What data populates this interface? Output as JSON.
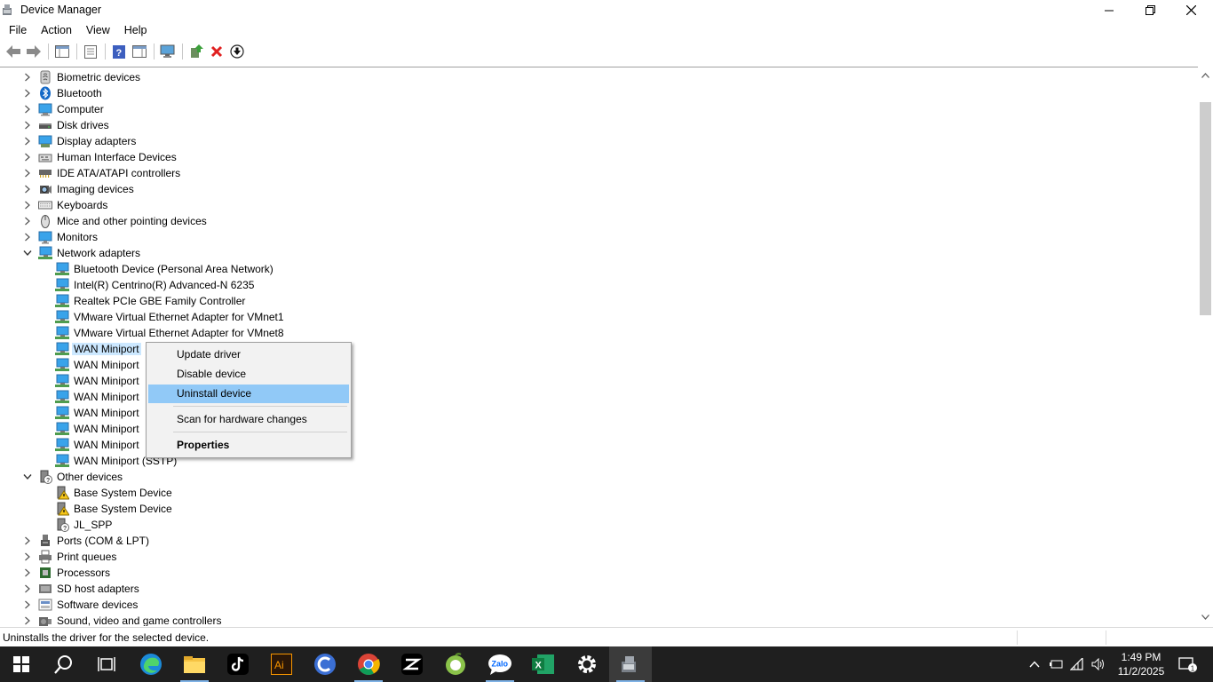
{
  "window": {
    "title": "Device Manager"
  },
  "menu": [
    "File",
    "Action",
    "View",
    "Help"
  ],
  "tree": [
    {
      "label": "Biometric devices",
      "level": 0,
      "state": "collapsed",
      "icon": "biometric-icon"
    },
    {
      "label": "Bluetooth",
      "level": 0,
      "state": "collapsed",
      "icon": "bluetooth-icon"
    },
    {
      "label": "Computer",
      "level": 0,
      "state": "collapsed",
      "icon": "computer-icon"
    },
    {
      "label": "Disk drives",
      "level": 0,
      "state": "collapsed",
      "icon": "disk-drive-icon"
    },
    {
      "label": "Display adapters",
      "level": 0,
      "state": "collapsed",
      "icon": "display-adapter-icon"
    },
    {
      "label": "Human Interface Devices",
      "level": 0,
      "state": "collapsed",
      "icon": "hid-icon"
    },
    {
      "label": "IDE ATA/ATAPI controllers",
      "level": 0,
      "state": "collapsed",
      "icon": "ide-controller-icon"
    },
    {
      "label": "Imaging devices",
      "level": 0,
      "state": "collapsed",
      "icon": "camera-icon"
    },
    {
      "label": "Keyboards",
      "level": 0,
      "state": "collapsed",
      "icon": "keyboard-icon"
    },
    {
      "label": "Mice and other pointing devices",
      "level": 0,
      "state": "collapsed",
      "icon": "mouse-icon"
    },
    {
      "label": "Monitors",
      "level": 0,
      "state": "collapsed",
      "icon": "monitor-icon"
    },
    {
      "label": "Network adapters",
      "level": 0,
      "state": "expanded",
      "icon": "network-adapter-icon"
    },
    {
      "label": "Bluetooth Device (Personal Area Network)",
      "level": 1,
      "icon": "network-adapter-icon"
    },
    {
      "label": "Intel(R) Centrino(R) Advanced-N 6235",
      "level": 1,
      "icon": "network-adapter-icon"
    },
    {
      "label": "Realtek PCIe GBE Family Controller",
      "level": 1,
      "icon": "network-adapter-icon"
    },
    {
      "label": "VMware Virtual Ethernet Adapter for VMnet1",
      "level": 1,
      "icon": "network-adapter-icon"
    },
    {
      "label": "VMware Virtual Ethernet Adapter for VMnet8",
      "level": 1,
      "icon": "network-adapter-icon"
    },
    {
      "label": "WAN Miniport",
      "level": 1,
      "icon": "network-adapter-icon",
      "selected": true
    },
    {
      "label": "WAN Miniport",
      "level": 1,
      "icon": "network-adapter-icon"
    },
    {
      "label": "WAN Miniport",
      "level": 1,
      "icon": "network-adapter-icon"
    },
    {
      "label": "WAN Miniport",
      "level": 1,
      "icon": "network-adapter-icon"
    },
    {
      "label": "WAN Miniport",
      "level": 1,
      "icon": "network-adapter-icon"
    },
    {
      "label": "WAN Miniport",
      "level": 1,
      "icon": "network-adapter-icon"
    },
    {
      "label": "WAN Miniport",
      "level": 1,
      "icon": "network-adapter-icon"
    },
    {
      "label": "WAN Miniport (SSTP)",
      "level": 1,
      "icon": "network-adapter-icon"
    },
    {
      "label": "Other devices",
      "level": 0,
      "state": "expanded",
      "icon": "unknown-device-icon"
    },
    {
      "label": "Base System Device",
      "level": 1,
      "icon": "warning-device-icon"
    },
    {
      "label": "Base System Device",
      "level": 1,
      "icon": "warning-device-icon"
    },
    {
      "label": "JL_SPP",
      "level": 1,
      "icon": "unknown-device-icon"
    },
    {
      "label": "Ports (COM & LPT)",
      "level": 0,
      "state": "collapsed",
      "icon": "port-icon"
    },
    {
      "label": "Print queues",
      "level": 0,
      "state": "collapsed",
      "icon": "printer-icon"
    },
    {
      "label": "Processors",
      "level": 0,
      "state": "collapsed",
      "icon": "processor-icon"
    },
    {
      "label": "SD host adapters",
      "level": 0,
      "state": "collapsed",
      "icon": "sd-host-icon"
    },
    {
      "label": "Software devices",
      "level": 0,
      "state": "collapsed",
      "icon": "software-device-icon"
    },
    {
      "label": "Sound, video and game controllers",
      "level": 0,
      "state": "collapsed",
      "icon": "sound-icon"
    }
  ],
  "context_menu": {
    "update": "Update driver",
    "disable": "Disable device",
    "uninstall": "Uninstall device",
    "scan": "Scan for hardware changes",
    "properties": "Properties"
  },
  "status": {
    "text": "Uninstalls the driver for the selected device."
  },
  "taskbar": {
    "apps": [
      "start-icon",
      "search-icon",
      "task-view-icon",
      "edge-icon",
      "file-explorer-icon",
      "tiktok-icon",
      "illustrator-icon",
      "capcut-icon",
      "chrome-icon",
      "capcut-desktop-icon",
      "app-icon",
      "zalo-icon",
      "excel-icon",
      "settings-icon",
      "device-manager-icon"
    ],
    "illustrator_label": "Ai",
    "excel_label": "X",
    "zalo_label": "Zalo",
    "clock_time": "1:49 PM",
    "clock_date": "11/2/2025",
    "notification_count": "1"
  },
  "colors": {
    "accent": "#0078d7",
    "selection": "#cce8ff",
    "menu_highlight": "#91c9f7",
    "taskbar": "#1f1f1f"
  }
}
